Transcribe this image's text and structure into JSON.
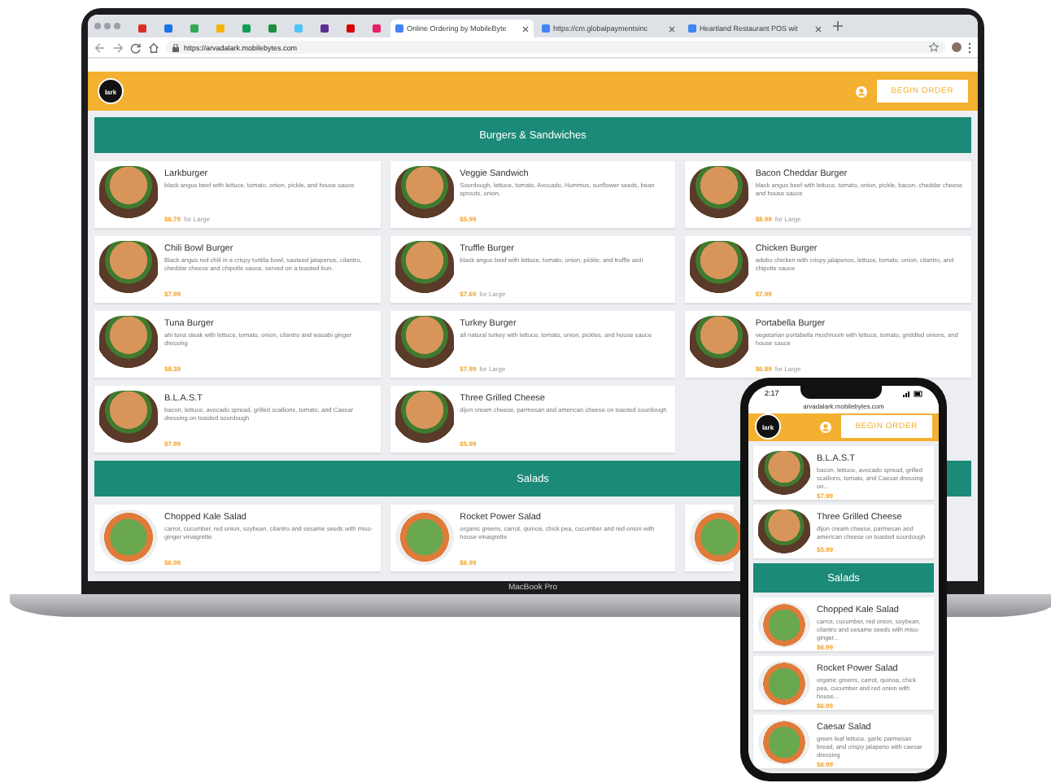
{
  "browser": {
    "pinned_tabs": [
      {
        "color": "#d93025"
      },
      {
        "color": "#1a73e8"
      },
      {
        "color": "#34a853"
      },
      {
        "color": "#f4b400"
      },
      {
        "color": "#0f9d58"
      },
      {
        "color": "#1e8e3e"
      },
      {
        "color": "#4fc3f7"
      },
      {
        "color": "#5c2d91"
      },
      {
        "color": "#d50000"
      },
      {
        "color": "#e91e63"
      }
    ],
    "tabs": [
      {
        "title": "Online Ordering by MobileByte",
        "selected": true
      },
      {
        "title": "https://cm.globalpaymentsinc",
        "selected": false
      },
      {
        "title": "Heartland Restaurant POS wit",
        "selected": false
      }
    ],
    "url": "https://arvadalark.mobilebytes.com"
  },
  "site": {
    "logo": "lark",
    "begin_order": "BEGIN ORDER"
  },
  "sections": [
    {
      "title": "Burgers & Sandwiches",
      "items": [
        {
          "name": "Larkburger",
          "description": "black angus beef with lettuce, tomato, onion, pickle, and house sauce",
          "price": "$6.79",
          "suffix": "for Large"
        },
        {
          "name": "Veggie Sandwich",
          "description": "Sourdough, lettuce, tomato, Avocado, Hummus, sunflower seeds, bean sprouts, onion.",
          "price": "$5.99"
        },
        {
          "name": "Bacon Cheddar Burger",
          "description": "black angus beef with lettuce, tomato, onion, pickle, bacon, cheddar cheese and house sauce",
          "price": "$8.99",
          "suffix": "for Large"
        },
        {
          "name": "Chili Bowl Burger",
          "description": "Black angus red chili in a crispy tortilla bowl, sauteed jalapenos, cilantro, cheddar cheese and chipotle sauce, served on a toasted bun.",
          "price": "$7.99"
        },
        {
          "name": "Truffle Burger",
          "description": "black angus beef with lettuce, tomato, onion, pickle, and truffle aioli",
          "price": "$7.69",
          "suffix": "for Large"
        },
        {
          "name": "Chicken Burger",
          "description": "adobo chicken with crispy jalapenos, lettuce, tomato, onion, cilantro, and chipotle sauce",
          "price": "$7.99"
        },
        {
          "name": "Tuna Burger",
          "description": "ahi tuna steak with lettuce, tomato, onion, cilantro and wasabi ginger dressing",
          "price": "$8.39"
        },
        {
          "name": "Turkey Burger",
          "description": "all natural turkey with lettuce, tomato, onion, pickles, and house sauce",
          "price": "$7.99",
          "suffix": "for Large"
        },
        {
          "name": "Portabella Burger",
          "description": "vegetarian portabella mushroom with lettuce, tomato, griddled onions, and house sauce",
          "price": "$6.89",
          "suffix": "for Large"
        },
        {
          "name": "B.L.A.S.T",
          "description": "bacon, lettuce, avocado spread, grilled scallions, tomato, and Caesar dressing on toasted sourdough",
          "price": "$7.99"
        },
        {
          "name": "Three Grilled Cheese",
          "description": "dijon cream cheese, parmesan and american cheese on toasted sourdough",
          "price": "$5.99"
        }
      ]
    },
    {
      "title": "Salads",
      "items": [
        {
          "kind": "item",
          "name": "Chopped Kale Salad",
          "description": "carrot, cucumber, red onion, soybean, cilantro and sesame seeds with miso-ginger vinaigrette",
          "price": "$6.99"
        },
        {
          "kind": "item",
          "name": "Rocket Power Salad",
          "description": "organic greens, carrot, quinoa, chick pea, cucumber and red onion with house vinaigrette",
          "price": "$6.99"
        },
        {
          "kind": "photo_only"
        }
      ]
    }
  ],
  "laptop_label": "MacBook Pro",
  "phone": {
    "time": "2:17",
    "url": "arvadalark.mobilebytes.com",
    "logo": "lark",
    "begin_order": "BEGIN ORDER",
    "items": [
      {
        "kind": "item",
        "name": "B.L.A.S.T",
        "description": "bacon, lettuce, avocado spread, grilled scallions, tomato, and Caesar dressing on...",
        "price": "$7.99"
      },
      {
        "kind": "item",
        "name": "Three Grilled Cheese",
        "description": "dijon cream cheese, parmesan and american cheese on toasted sourdough",
        "price": "$5.99"
      },
      {
        "kind": "section",
        "title": "Salads"
      },
      {
        "kind": "item",
        "name": "Chopped Kale Salad",
        "description": "carrot, cucumber, red onion, soybean, cilantro and sesame seeds with miso-ginger...",
        "price": "$6.99"
      },
      {
        "kind": "item",
        "name": "Rocket Power Salad",
        "description": "organic greens, carrot, quinoa, chick pea, cucumber and red onion with house...",
        "price": "$6.99"
      },
      {
        "kind": "item",
        "name": "Caesar Salad",
        "description": "green leaf lettuce, garlic parmesan bread, and crispy jalapeno with caesar dressing",
        "price": "$6.99"
      }
    ]
  }
}
